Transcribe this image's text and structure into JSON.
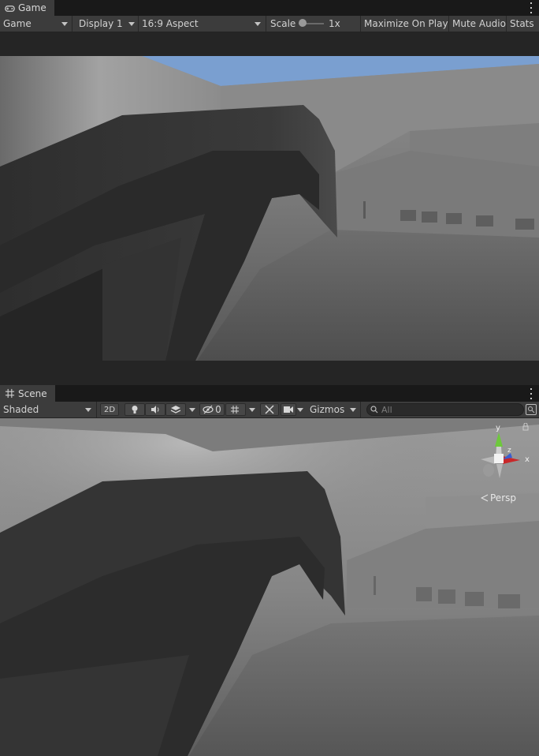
{
  "game": {
    "tab_label": "Game",
    "toolbar": {
      "mode": "Game",
      "display": "Display 1",
      "aspect": "16:9 Aspect",
      "scale_label": "Scale",
      "scale_value": "1x",
      "scale_fraction": 0.0,
      "maximize_on_play": "Maximize On Play",
      "mute_audio": "Mute Audio",
      "stats": "Stats"
    }
  },
  "scene": {
    "tab_label": "Scene",
    "toolbar": {
      "draw_mode": "Shaded",
      "two_d": "2D",
      "hidden_count": "0",
      "gizmos": "Gizmos",
      "search_placeholder": "All"
    },
    "gizmo": {
      "y_label": "y",
      "x_label": "x",
      "z_label": "z",
      "projection": "Persp"
    }
  },
  "colors": {
    "panel_background": "#3c3c3c",
    "sky": "#7a9fd0",
    "axis_x": "#c8282a",
    "axis_y": "#6ec83c",
    "axis_z": "#3a5fd0"
  }
}
